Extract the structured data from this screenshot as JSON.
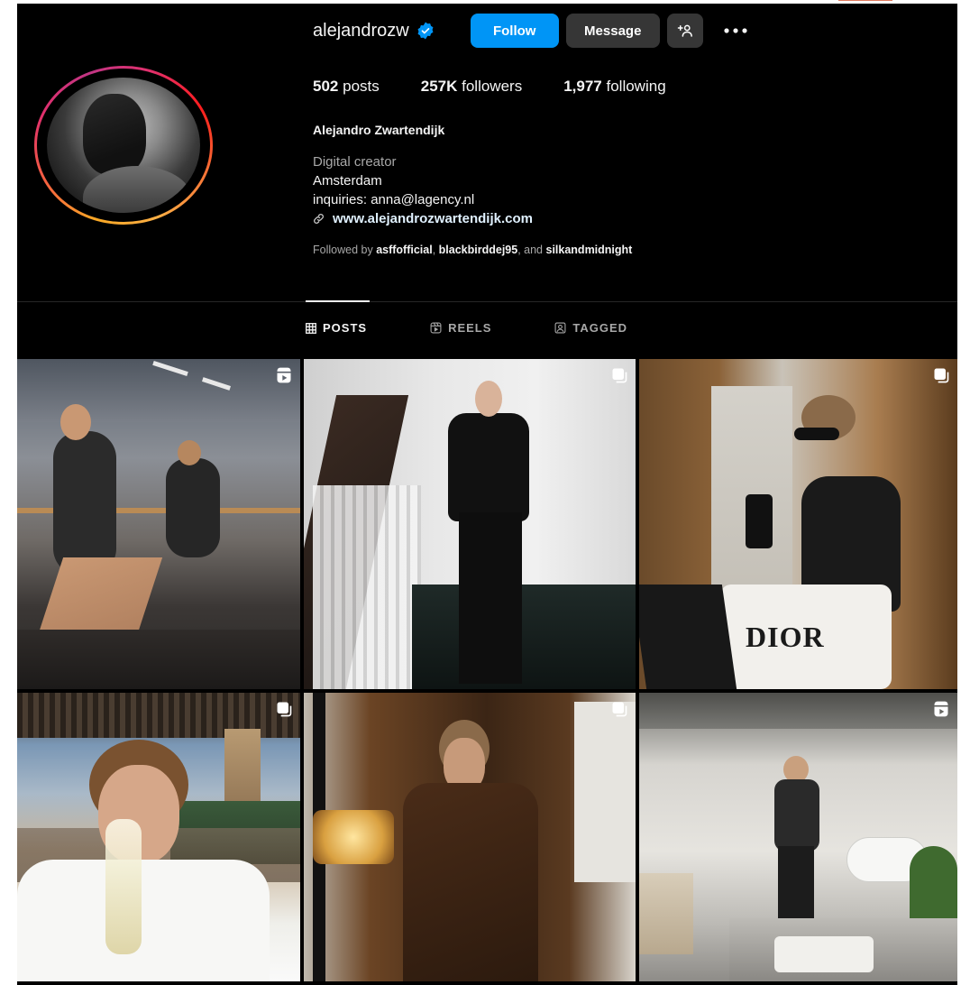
{
  "profile": {
    "username": "alejandrozw",
    "follow_label": "Follow",
    "message_label": "Message",
    "stats": {
      "posts_count": "502",
      "posts_label": "posts",
      "followers_count": "257K",
      "followers_label": "followers",
      "following_count": "1,977",
      "following_label": "following"
    },
    "full_name": "Alejandro Zwartendijk",
    "category": "Digital creator",
    "bio_line1": "Amsterdam",
    "bio_line2": "inquiries: anna@lagency.nl",
    "website": "www.alejandrozwartendijk.com",
    "followed_by": {
      "prefix": "Followed by",
      "user1": "asffofficial",
      "user2": "blackbirddej95",
      "and_text": "and",
      "user3": "silkandmidnight"
    }
  },
  "tabs": [
    {
      "label": "POSTS",
      "icon": "grid-icon",
      "active": true
    },
    {
      "label": "REELS",
      "icon": "reels-icon",
      "active": false
    },
    {
      "label": "TAGGED",
      "icon": "tagged-icon",
      "active": false
    }
  ],
  "posts": [
    {
      "badge": "reel-icon"
    },
    {
      "badge": "carousel-icon"
    },
    {
      "badge": "carousel-icon",
      "overlay_text": "DIOR"
    },
    {
      "badge": "carousel-icon"
    },
    {
      "badge": "carousel-icon"
    },
    {
      "badge": "reel-icon"
    }
  ],
  "colors": {
    "background": "#000000",
    "follow_button": "#0095f6",
    "secondary_button": "#363636",
    "verified": "#0095f6",
    "muted_text": "#a8a8a8"
  }
}
